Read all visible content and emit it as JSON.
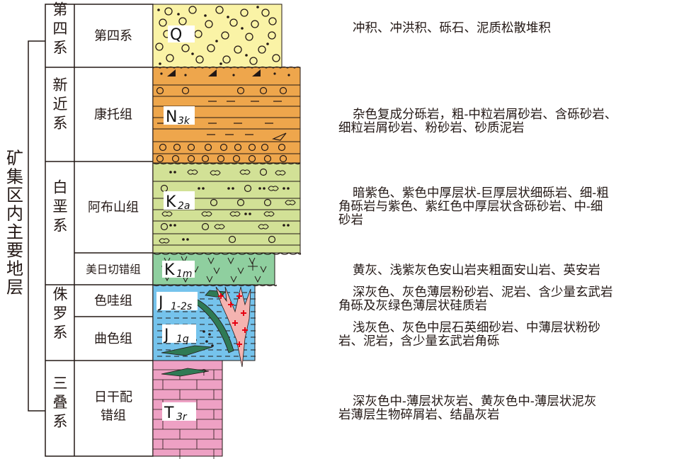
{
  "title": "矿集区内主要地层",
  "systems": [
    "第四系",
    "新近系",
    "白垩系",
    "侏罗系",
    "三叠系"
  ],
  "formations": [
    "第四系",
    "康托组",
    "阿布山组",
    "美日切错组",
    "色哇组",
    "曲色组",
    "日干配错组"
  ],
  "codes": [
    {
      "main": "Q",
      "sub": ""
    },
    {
      "main": "N",
      "sub": "3k"
    },
    {
      "main": "K",
      "sub": "2a"
    },
    {
      "main": "K",
      "sub": "1m"
    },
    {
      "main": "J",
      "sub": "1-2s"
    },
    {
      "main": "J",
      "sub": "1q"
    },
    {
      "main": "T",
      "sub": "3r"
    }
  ],
  "question_mark": "?",
  "descriptions": [
    [
      "冲积、冲洪积、砾石、泥质松散堆积"
    ],
    [
      "杂色复成分砾岩，粗-中粒岩屑砂岩、含砾砂岩、",
      "细粒岩屑砂岩、粉砂岩、砂质泥岩"
    ],
    [
      "暗紫色、紫色中厚层状-巨厚层状细砾岩、细-粗",
      "角砾岩与紫色、紫红色中厚层状含砾砂岩、中-细",
      "砂岩"
    ],
    [
      "黄灰、浅紫灰色安山岩夹粗面安山岩、英安岩"
    ],
    [
      "深灰色、灰色薄层粉砂岩、泥岩、含少量玄武岩",
      "角砾及灰绿色薄层状硅质岩"
    ],
    [
      "浅灰色、灰色中层石英细砂岩、中薄层状粉砂",
      "岩、泥岩，含少量玄武岩角砾"
    ],
    [
      "深灰色中-薄层状灰岩、黄灰色中-薄层状泥灰",
      "岩薄层生物碎屑岩、结晶灰岩"
    ]
  ],
  "colors": {
    "quaternary": "#faf3a6",
    "neogene": "#eea64c",
    "abushan": "#d2e196",
    "meiriqie": "#8fcf9f",
    "jurassic": "#75c3ec",
    "triassic": "#eea1c4",
    "basalt": "#2f7a55",
    "intrusion": "#f4b3b0",
    "intrusion_cross": "#e60012",
    "line": "#231815"
  }
}
